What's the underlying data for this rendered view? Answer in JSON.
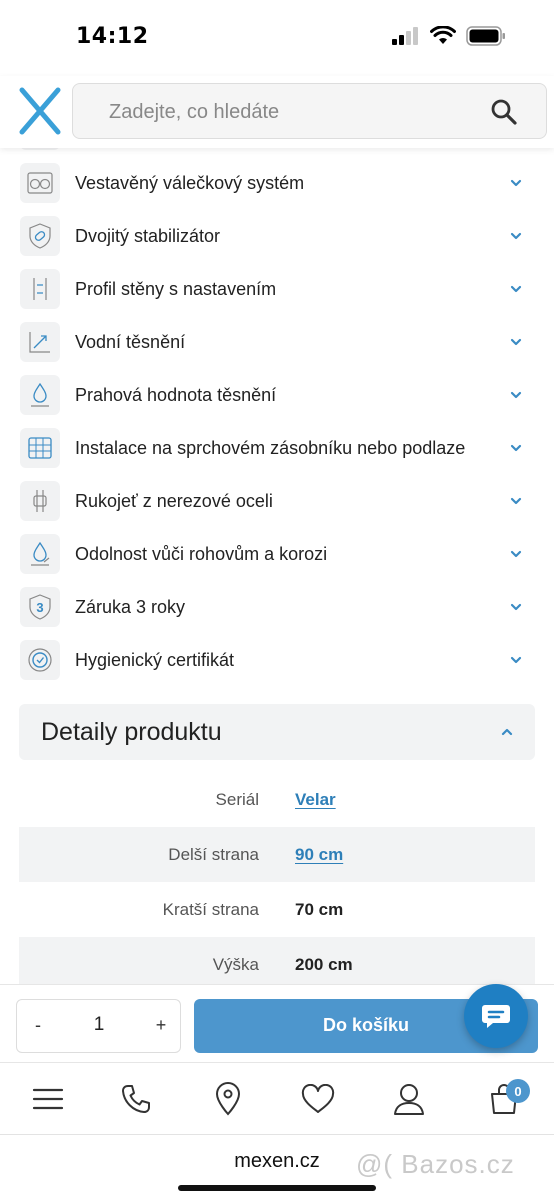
{
  "status_bar": {
    "time": "14:12"
  },
  "header": {
    "search_placeholder": "Zadejte, co hledáte"
  },
  "features": [
    {
      "label": "Vestavěný válečkový systém",
      "icon": "rollers-icon"
    },
    {
      "label": "Dvojitý stabilizátor",
      "icon": "stabilizer-icon"
    },
    {
      "label": "Profil stěny s nastavením",
      "icon": "wall-profile-icon"
    },
    {
      "label": "Vodní těsnění",
      "icon": "water-seal-icon"
    },
    {
      "label": "Prahová hodnota těsnění",
      "icon": "threshold-seal-icon"
    },
    {
      "label": "Instalace na sprchovém zásobníku nebo podlaze",
      "icon": "installation-icon"
    },
    {
      "label": "Rukojeť z nerezové oceli",
      "icon": "handle-icon"
    },
    {
      "label": "Odolnost vůči rohovům a korozi",
      "icon": "corrosion-icon"
    },
    {
      "label": "Záruka 3 roky",
      "icon": "warranty-3-icon",
      "badge": "3"
    },
    {
      "label": "Hygienický certifikát",
      "icon": "hygiene-certificate-icon"
    }
  ],
  "details": {
    "title": "Detaily produktu",
    "rows": [
      {
        "label": "Seriál",
        "value": "Velar",
        "link": true
      },
      {
        "label": "Delší strana",
        "value": "90 cm",
        "link": true
      },
      {
        "label": "Kratší strana",
        "value": "70 cm",
        "link": false
      },
      {
        "label": "Výška",
        "value": "200 cm",
        "link": false
      }
    ]
  },
  "cart": {
    "minus": "-",
    "quantity": "1",
    "plus": "+",
    "add_label": "Do košíku"
  },
  "nav": {
    "cart_count": "0"
  },
  "browser": {
    "url": "mexen.cz",
    "watermark": "@( Bazos.cz"
  },
  "colors": {
    "accent": "#4d96cd",
    "link": "#2e7fb8",
    "chat": "#1f7fc3"
  }
}
